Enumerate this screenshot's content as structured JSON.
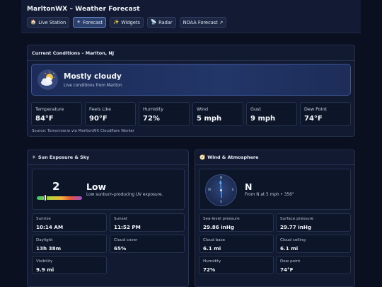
{
  "header": {
    "title": "MarltonWX – Weather Forecast",
    "nav": [
      {
        "label": "Live Station",
        "icon": "house-icon"
      },
      {
        "label": "Forecast",
        "icon": "sun-icon",
        "active": true
      },
      {
        "label": "Widgets",
        "icon": "sparkles-icon"
      },
      {
        "label": "Radar",
        "icon": "satellite-icon"
      },
      {
        "label": "NOAA Forecast ↗",
        "icon": ""
      }
    ]
  },
  "current": {
    "title": "Current Conditions – Marlton, NJ",
    "condition": "Mostly cloudy",
    "subtitle": "Live conditions from Marlton",
    "icon": "sun-behind-cloud-icon",
    "metrics": [
      {
        "label": "Temperature",
        "value": "84°F"
      },
      {
        "label": "Feels Like",
        "value": "90°F"
      },
      {
        "label": "Humidity",
        "value": "72%"
      },
      {
        "label": "Wind",
        "value": "5 mph"
      },
      {
        "label": "Gust",
        "value": "9 mph"
      },
      {
        "label": "Dew Point",
        "value": "74°F"
      }
    ],
    "source": "Source: Tomorrow.io via MarltonWX Cloudflare Worker"
  },
  "sun": {
    "title": "Sun Exposure & Sky",
    "uv_index": "2",
    "uv_level": "Low",
    "uv_description": "Low sunburn-producing UV exposure.",
    "uv_fraction": 0.18,
    "tiles": [
      {
        "label": "Sunrise",
        "value": "10:14 AM"
      },
      {
        "label": "Sunset",
        "value": "11:52 PM"
      },
      {
        "label": "Daylight",
        "value": "13h 38m"
      },
      {
        "label": "Cloud cover",
        "value": "65%"
      },
      {
        "label": "Visibility",
        "value": "9.9 mi"
      }
    ]
  },
  "wind": {
    "title": "Wind & Atmosphere",
    "direction": "N",
    "description": "From N at 5 mph • 356°",
    "degrees": 356,
    "compass": {
      "n": "N",
      "e": "E",
      "s": "S",
      "w": "W"
    },
    "tiles": [
      {
        "label": "Sea-level pressure",
        "value": "29.86 inHg"
      },
      {
        "label": "Surface pressure",
        "value": "29.77 inHg"
      },
      {
        "label": "Cloud base",
        "value": "6.1 mi"
      },
      {
        "label": "Cloud ceiling",
        "value": "6.1 mi"
      },
      {
        "label": "Humidity",
        "value": "72%"
      },
      {
        "label": "Dew point",
        "value": "74°F"
      }
    ]
  },
  "colors": {
    "background": "#0b1020",
    "card": "#111a31",
    "accent": "#5f80c0",
    "compass_needle": "#4fa3ff"
  }
}
